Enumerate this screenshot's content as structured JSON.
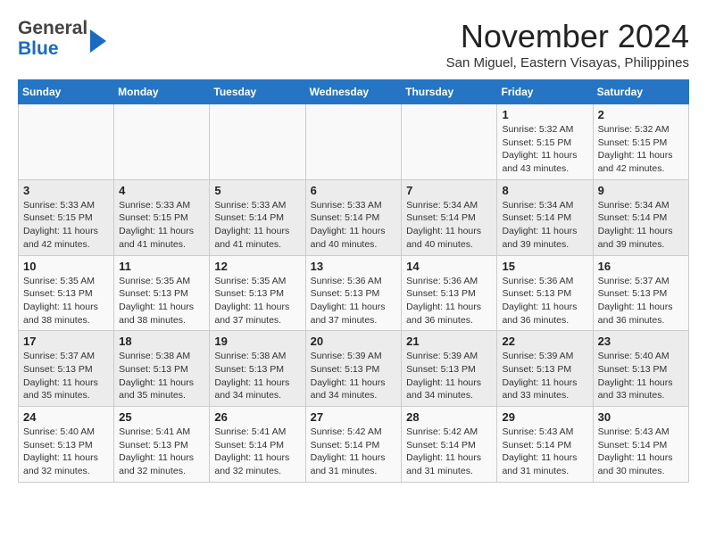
{
  "header": {
    "month_title": "November 2024",
    "location": "San Miguel, Eastern Visayas, Philippines",
    "logo_general": "General",
    "logo_blue": "Blue"
  },
  "calendar": {
    "days_of_week": [
      "Sunday",
      "Monday",
      "Tuesday",
      "Wednesday",
      "Thursday",
      "Friday",
      "Saturday"
    ],
    "weeks": [
      [
        {
          "day": "",
          "info": ""
        },
        {
          "day": "",
          "info": ""
        },
        {
          "day": "",
          "info": ""
        },
        {
          "day": "",
          "info": ""
        },
        {
          "day": "",
          "info": ""
        },
        {
          "day": "1",
          "info": "Sunrise: 5:32 AM\nSunset: 5:15 PM\nDaylight: 11 hours and 43 minutes."
        },
        {
          "day": "2",
          "info": "Sunrise: 5:32 AM\nSunset: 5:15 PM\nDaylight: 11 hours and 42 minutes."
        }
      ],
      [
        {
          "day": "3",
          "info": "Sunrise: 5:33 AM\nSunset: 5:15 PM\nDaylight: 11 hours and 42 minutes."
        },
        {
          "day": "4",
          "info": "Sunrise: 5:33 AM\nSunset: 5:15 PM\nDaylight: 11 hours and 41 minutes."
        },
        {
          "day": "5",
          "info": "Sunrise: 5:33 AM\nSunset: 5:14 PM\nDaylight: 11 hours and 41 minutes."
        },
        {
          "day": "6",
          "info": "Sunrise: 5:33 AM\nSunset: 5:14 PM\nDaylight: 11 hours and 40 minutes."
        },
        {
          "day": "7",
          "info": "Sunrise: 5:34 AM\nSunset: 5:14 PM\nDaylight: 11 hours and 40 minutes."
        },
        {
          "day": "8",
          "info": "Sunrise: 5:34 AM\nSunset: 5:14 PM\nDaylight: 11 hours and 39 minutes."
        },
        {
          "day": "9",
          "info": "Sunrise: 5:34 AM\nSunset: 5:14 PM\nDaylight: 11 hours and 39 minutes."
        }
      ],
      [
        {
          "day": "10",
          "info": "Sunrise: 5:35 AM\nSunset: 5:13 PM\nDaylight: 11 hours and 38 minutes."
        },
        {
          "day": "11",
          "info": "Sunrise: 5:35 AM\nSunset: 5:13 PM\nDaylight: 11 hours and 38 minutes."
        },
        {
          "day": "12",
          "info": "Sunrise: 5:35 AM\nSunset: 5:13 PM\nDaylight: 11 hours and 37 minutes."
        },
        {
          "day": "13",
          "info": "Sunrise: 5:36 AM\nSunset: 5:13 PM\nDaylight: 11 hours and 37 minutes."
        },
        {
          "day": "14",
          "info": "Sunrise: 5:36 AM\nSunset: 5:13 PM\nDaylight: 11 hours and 36 minutes."
        },
        {
          "day": "15",
          "info": "Sunrise: 5:36 AM\nSunset: 5:13 PM\nDaylight: 11 hours and 36 minutes."
        },
        {
          "day": "16",
          "info": "Sunrise: 5:37 AM\nSunset: 5:13 PM\nDaylight: 11 hours and 36 minutes."
        }
      ],
      [
        {
          "day": "17",
          "info": "Sunrise: 5:37 AM\nSunset: 5:13 PM\nDaylight: 11 hours and 35 minutes."
        },
        {
          "day": "18",
          "info": "Sunrise: 5:38 AM\nSunset: 5:13 PM\nDaylight: 11 hours and 35 minutes."
        },
        {
          "day": "19",
          "info": "Sunrise: 5:38 AM\nSunset: 5:13 PM\nDaylight: 11 hours and 34 minutes."
        },
        {
          "day": "20",
          "info": "Sunrise: 5:39 AM\nSunset: 5:13 PM\nDaylight: 11 hours and 34 minutes."
        },
        {
          "day": "21",
          "info": "Sunrise: 5:39 AM\nSunset: 5:13 PM\nDaylight: 11 hours and 34 minutes."
        },
        {
          "day": "22",
          "info": "Sunrise: 5:39 AM\nSunset: 5:13 PM\nDaylight: 11 hours and 33 minutes."
        },
        {
          "day": "23",
          "info": "Sunrise: 5:40 AM\nSunset: 5:13 PM\nDaylight: 11 hours and 33 minutes."
        }
      ],
      [
        {
          "day": "24",
          "info": "Sunrise: 5:40 AM\nSunset: 5:13 PM\nDaylight: 11 hours and 32 minutes."
        },
        {
          "day": "25",
          "info": "Sunrise: 5:41 AM\nSunset: 5:13 PM\nDaylight: 11 hours and 32 minutes."
        },
        {
          "day": "26",
          "info": "Sunrise: 5:41 AM\nSunset: 5:14 PM\nDaylight: 11 hours and 32 minutes."
        },
        {
          "day": "27",
          "info": "Sunrise: 5:42 AM\nSunset: 5:14 PM\nDaylight: 11 hours and 31 minutes."
        },
        {
          "day": "28",
          "info": "Sunrise: 5:42 AM\nSunset: 5:14 PM\nDaylight: 11 hours and 31 minutes."
        },
        {
          "day": "29",
          "info": "Sunrise: 5:43 AM\nSunset: 5:14 PM\nDaylight: 11 hours and 31 minutes."
        },
        {
          "day": "30",
          "info": "Sunrise: 5:43 AM\nSunset: 5:14 PM\nDaylight: 11 hours and 30 minutes."
        }
      ]
    ]
  }
}
